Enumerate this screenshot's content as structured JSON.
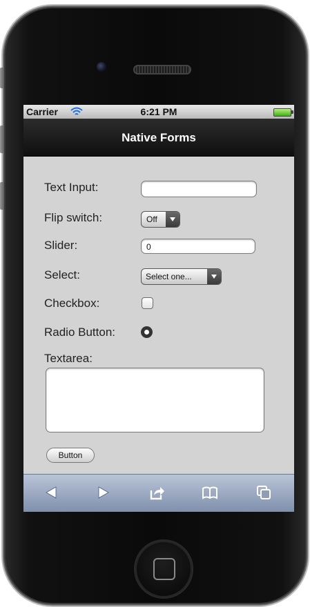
{
  "status_bar": {
    "carrier": "Carrier",
    "time": "6:21 PM",
    "wifi_icon": "wifi-icon",
    "battery_icon": "battery-icon"
  },
  "nav_bar": {
    "title": "Native Forms"
  },
  "form": {
    "text_input": {
      "label": "Text Input:",
      "value": ""
    },
    "flip_switch": {
      "label": "Flip switch:",
      "value": "Off"
    },
    "slider": {
      "label": "Slider:",
      "value": "0"
    },
    "select": {
      "label": "Select:",
      "value": "Select one..."
    },
    "checkbox": {
      "label": "Checkbox:",
      "checked": false
    },
    "radio": {
      "label": "Radio Button:",
      "selected": true
    },
    "textarea": {
      "label": "Textarea:",
      "value": ""
    },
    "button": {
      "label": "Button"
    }
  },
  "toolbar": {
    "items": [
      "back-arrow-icon",
      "forward-arrow-icon",
      "share-icon",
      "bookmarks-icon",
      "tabs-icon"
    ]
  },
  "colors": {
    "screen_bg": "#d3d3d3",
    "navbar_bg": "#1a1a1a",
    "toolbar_bg": "#9aa7bf"
  }
}
